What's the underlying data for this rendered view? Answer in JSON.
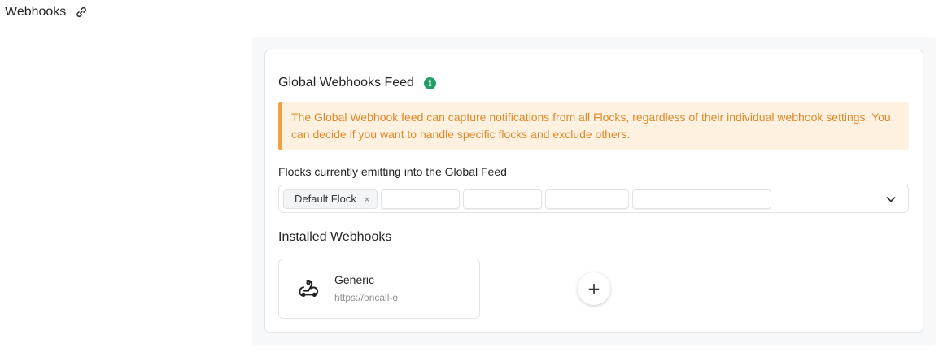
{
  "header": {
    "title": "Webhooks",
    "link_icon": "link-icon"
  },
  "global_feed": {
    "title": "Global Webhooks Feed",
    "info_icon": "info-icon",
    "info_color": "#1f9d63",
    "alert_text": "The Global Webhook feed can capture notifications from all Flocks, regardless of their individual webhook settings. You can decide if you want to handle specific flocks and exclude others.",
    "alert_color": "#e1892a",
    "alert_background": "#fff1e0",
    "flocks_label": "Flocks currently emitting into the Global Feed",
    "selected_flocks": [
      {
        "label": "Default Flock",
        "remove_icon": "×"
      },
      {
        "label": ""
      },
      {
        "label": ""
      },
      {
        "label": ""
      },
      {
        "label": ""
      }
    ],
    "dropdown_icon": "chevron-down-icon"
  },
  "installed": {
    "title": "Installed Webhooks",
    "webhooks": [
      {
        "name": "Generic",
        "url": "https://oncall-o",
        "icon": "webhook-icon"
      }
    ],
    "add_label": "+"
  }
}
